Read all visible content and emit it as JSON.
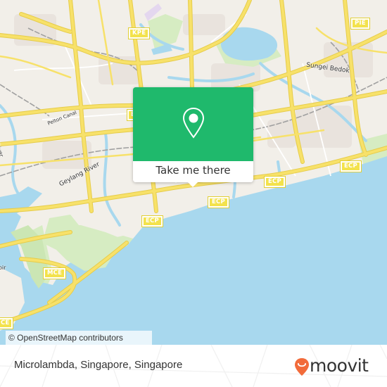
{
  "map": {
    "colors": {
      "land": "#f2efe9",
      "water": "#a8d8ee",
      "park": "#cbe6b4",
      "road": "#f7e16a",
      "road_outline": "#e6cc4a",
      "rail": "#9a9a9a"
    },
    "shields": [
      {
        "id": "kpe",
        "label": "KPE"
      },
      {
        "id": "pie",
        "label": "PIE"
      },
      {
        "id": "ecp1",
        "label": "ECP"
      },
      {
        "id": "ecp2",
        "label": "ECP"
      },
      {
        "id": "ecp3",
        "label": "ECP"
      },
      {
        "id": "ecp4",
        "label": "ECP"
      },
      {
        "id": "mce1",
        "label": "MCE"
      },
      {
        "id": "mce2",
        "label": "CE"
      },
      {
        "id": "e1",
        "label": "E"
      }
    ],
    "labels": {
      "sungei_bedok": "Sungei Bedok",
      "geylang_river": "Geylang River",
      "pelton_canal": "Pelton Canal",
      "kallang_river": "Kallang River",
      "partial_left": "oir"
    },
    "attribution": "© OpenStreetMap contributors"
  },
  "popup": {
    "icon": "map-pin-icon",
    "button_label": "Take me there",
    "color": "#1fb96c"
  },
  "footer": {
    "title": "Microlambda, Singapore, Singapore",
    "brand": {
      "name": "moovit",
      "icon": "moovit-smile-pin-icon",
      "color": "#f26b3a"
    }
  }
}
